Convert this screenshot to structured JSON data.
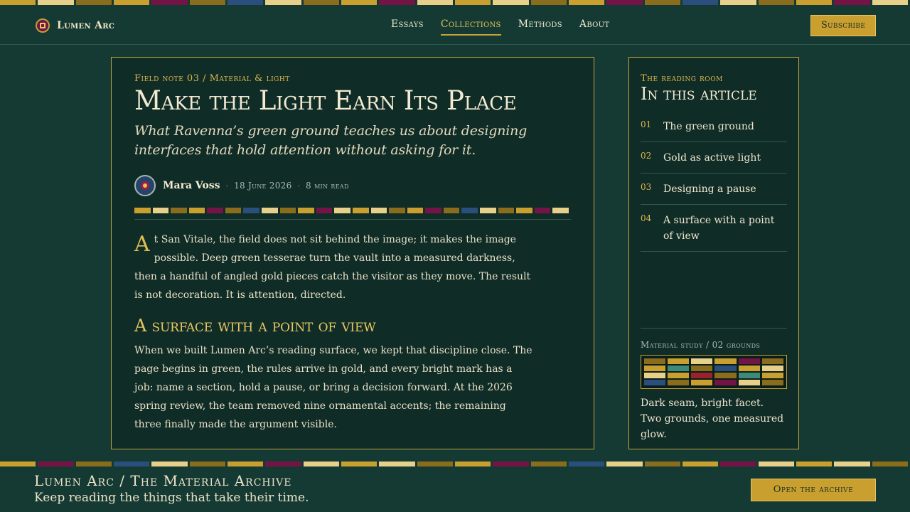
{
  "colors": {
    "background": "#153a33",
    "panel": "#102c27",
    "gold": "#c9a02f",
    "bright_gold": "#e0c35a",
    "pale_gold": "#e6d08a",
    "ochre": "#8a6d1c",
    "crimson": "#741446",
    "lapis": "#2a4f7c",
    "teal": "#3d8a7a",
    "red": "#9a2230"
  },
  "header": {
    "brand_name": "Lumen Arc",
    "logo_icon": "mosaic-tessera-icon",
    "nav": [
      {
        "label": "Essays",
        "active": false
      },
      {
        "label": "Collections",
        "active": true
      },
      {
        "label": "Methods",
        "active": false
      },
      {
        "label": "About",
        "active": false
      }
    ],
    "subscribe_label": "Subscribe"
  },
  "article": {
    "eyebrow": "Field note 03 / Material & light",
    "title": "Make the Light Earn Its Place",
    "dek": "What Ravenna’s green ground teaches us about designing interfaces that hold attention without asking for it.",
    "author": "Mara Voss",
    "date": "18 June 2026",
    "read_time": "8 min read",
    "drop_cap": "A",
    "paragraph_1": "t San Vitale, the field does not sit behind the image; it makes the image possible. Deep green tesserae turn the vault into a measured darkness, then a handful of angled gold pieces catch the visitor as they move. The result is not decoration. It is attention, directed.",
    "section_heading": "A surface with a point of view",
    "paragraph_2": "When we built Lumen Arc’s reading surface, we kept that discipline close. The page begins in green, the rules arrive in gold, and every bright mark has a job: name a section, hold a pause, or bring a decision forward. At the 2026 spring review, the team removed nine ornamental accents; the remaining three finally made the argument visible."
  },
  "sidebar": {
    "eyebrow": "The reading room",
    "title": "In this article",
    "toc": [
      {
        "num": "01",
        "label": "The green ground"
      },
      {
        "num": "02",
        "label": "Gold as active light"
      },
      {
        "num": "03",
        "label": "Designing a pause"
      },
      {
        "num": "04",
        "label": "A surface with a point of view"
      }
    ],
    "study_label": "Material study / 02 grounds",
    "study_caption": "Dark seam, bright facet. Two grounds, one measured glow."
  },
  "footer": {
    "title": "Lumen Arc / The Material Archive",
    "subtitle": "Keep reading the things that take their time.",
    "archive_label": "Open the archive"
  }
}
